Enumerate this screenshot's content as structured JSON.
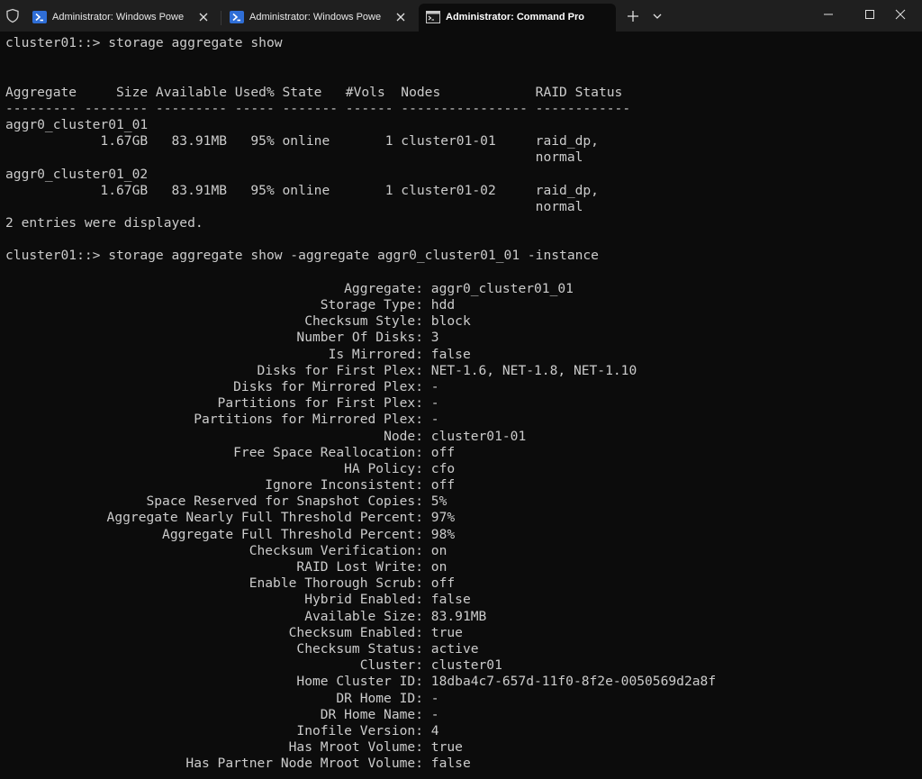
{
  "window": {
    "tabs": [
      {
        "title": "Administrator: Windows Powe",
        "icon": "powershell-icon",
        "active": false
      },
      {
        "title": "Administrator: Windows Powe",
        "icon": "powershell-icon",
        "active": false
      },
      {
        "title": "Administrator: Command Pro",
        "icon": "cmd-icon",
        "active": true
      }
    ],
    "colors": {
      "tabbar_bg": "#1f1f1f",
      "console_bg": "#0c0c0c",
      "console_fg": "#cccccc",
      "powershell_icon": "#2f6ed6"
    }
  },
  "console": {
    "prompt1": "cluster01::> storage aggregate show",
    "blank1": "",
    "blank2": "",
    "header": "Aggregate     Size Available Used% State   #Vols  Nodes            RAID Status",
    "divider": "--------- -------- --------- ----- ------- ------ ---------------- ------------",
    "rows": [
      {
        "name": "aggr0_cluster01_01",
        "line": "            1.67GB   83.91MB   95% online       1 cluster01-01     raid_dp,",
        "cont": "                                                                   normal"
      },
      {
        "name": "aggr0_cluster01_02",
        "line": "            1.67GB   83.91MB   95% online       1 cluster01-02     raid_dp,",
        "cont": "                                                                   normal"
      }
    ],
    "summary": "2 entries were displayed.",
    "blank3": "",
    "prompt2": "cluster01::> storage aggregate show -aggregate aggr0_cluster01_01 -instance",
    "blank4": "",
    "details": [
      {
        "label": "Aggregate:",
        "value": "aggr0_cluster01_01"
      },
      {
        "label": "Storage Type:",
        "value": "hdd"
      },
      {
        "label": "Checksum Style:",
        "value": "block"
      },
      {
        "label": "Number Of Disks:",
        "value": "3"
      },
      {
        "label": "Is Mirrored:",
        "value": "false"
      },
      {
        "label": "Disks for First Plex:",
        "value": "NET-1.6, NET-1.8, NET-1.10"
      },
      {
        "label": "Disks for Mirrored Plex:",
        "value": "-"
      },
      {
        "label": "Partitions for First Plex:",
        "value": "-"
      },
      {
        "label": "Partitions for Mirrored Plex:",
        "value": "-"
      },
      {
        "label": "Node:",
        "value": "cluster01-01"
      },
      {
        "label": "Free Space Reallocation:",
        "value": "off"
      },
      {
        "label": "HA Policy:",
        "value": "cfo"
      },
      {
        "label": "Ignore Inconsistent:",
        "value": "off"
      },
      {
        "label": "Space Reserved for Snapshot Copies:",
        "value": "5%"
      },
      {
        "label": "Aggregate Nearly Full Threshold Percent:",
        "value": "97%"
      },
      {
        "label": "Aggregate Full Threshold Percent:",
        "value": "98%"
      },
      {
        "label": "Checksum Verification:",
        "value": "on"
      },
      {
        "label": "RAID Lost Write:",
        "value": "on"
      },
      {
        "label": "Enable Thorough Scrub:",
        "value": "off"
      },
      {
        "label": "Hybrid Enabled:",
        "value": "false"
      },
      {
        "label": "Available Size:",
        "value": "83.91MB"
      },
      {
        "label": "Checksum Enabled:",
        "value": "true"
      },
      {
        "label": "Checksum Status:",
        "value": "active"
      },
      {
        "label": "Cluster:",
        "value": "cluster01"
      },
      {
        "label": "Home Cluster ID:",
        "value": "18dba4c7-657d-11f0-8f2e-0050569d2a8f"
      },
      {
        "label": "DR Home ID:",
        "value": "-"
      },
      {
        "label": "DR Home Name:",
        "value": "-"
      },
      {
        "label": "Inofile Version:",
        "value": "4"
      },
      {
        "label": "Has Mroot Volume:",
        "value": "true"
      },
      {
        "label": "Has Partner Node Mroot Volume:",
        "value": "false"
      }
    ]
  }
}
